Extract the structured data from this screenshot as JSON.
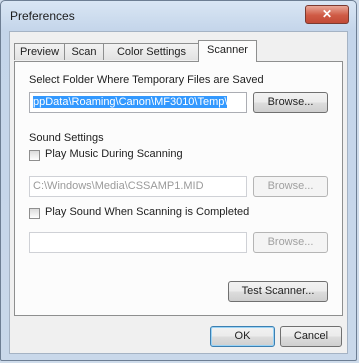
{
  "window": {
    "title": "Preferences",
    "close_glyph": "✕"
  },
  "tabs": [
    {
      "label": "Preview"
    },
    {
      "label": "Scan"
    },
    {
      "label": "Color Settings"
    },
    {
      "label": "Scanner"
    }
  ],
  "scanner": {
    "temp_folder_label": "Select Folder Where Temporary Files are Saved",
    "temp_folder_value": "ppData\\Roaming\\Canon\\MF3010\\Temp\\",
    "browse_label": "Browse...",
    "sound_settings_label": "Sound Settings",
    "play_music_label": "Play Music During Scanning",
    "play_music_checked": false,
    "music_path_value": "C:\\Windows\\Media\\CSSAMP1.MID",
    "play_sound_label": "Play Sound When Scanning is Completed",
    "play_sound_checked": false,
    "sound_path_value": "",
    "test_scanner_label": "Test Scanner..."
  },
  "footer": {
    "ok_label": "OK",
    "cancel_label": "Cancel"
  }
}
